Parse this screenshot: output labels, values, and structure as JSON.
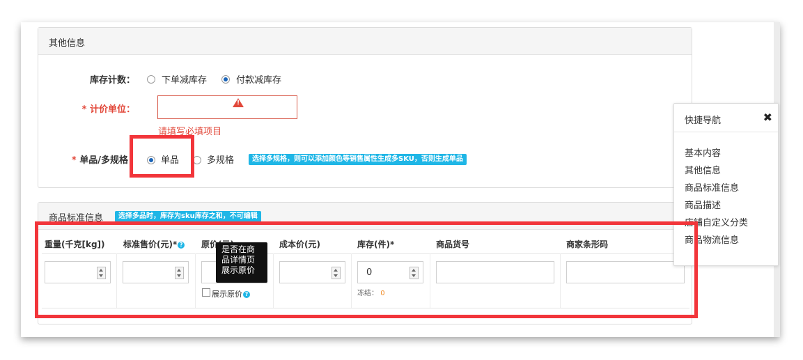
{
  "other_info": {
    "title": "其他信息",
    "stock_count": {
      "label": "库存计数：",
      "options": [
        "下单减库存",
        "付款减库存"
      ],
      "selected": "付款减库存"
    },
    "pricing_unit": {
      "required_mark": "*",
      "label": "计价单位：",
      "value": "",
      "error": "请填写必填项目"
    },
    "sku_mode": {
      "required_mark": "*",
      "label": "单品/多规格",
      "options": [
        "单品",
        "多规格"
      ],
      "selected": "单品",
      "hint": "选择多规格，则可以添加颜色等销售属性生成多SKU，否则生成单品"
    }
  },
  "standard_info": {
    "title": "商品标准信息",
    "hint": "选择多品时，库存为sku库存之和，不可编辑",
    "columns": [
      "重量(千克[kg])",
      "标准售价(元)*",
      "原价(元)",
      "成本价(元)",
      "库存(件)*",
      "商品货号",
      "商家条形码"
    ],
    "help_icon": "?",
    "values": {
      "weight": "",
      "std_price": "",
      "orig_price": "",
      "cost_price": "",
      "stock": "0",
      "sku_code": "",
      "barcode": ""
    },
    "show_orig_price_label": "展示原价",
    "frozen_label": "冻结：",
    "frozen_value": "0",
    "tooltip": [
      "是否在商",
      "品详情页",
      "展示原价"
    ]
  },
  "quick_nav": {
    "title": "快捷导航",
    "close_icon": "✖",
    "items": [
      "基本内容",
      "其他信息",
      "商品标准信息",
      "商品描述",
      "店铺自定义分类",
      "商品物流信息"
    ]
  },
  "colors": {
    "error": "#e2483a",
    "highlight": "#f2353a",
    "badge": "#1fb6e6",
    "radio_dot": "#1a64b8"
  }
}
